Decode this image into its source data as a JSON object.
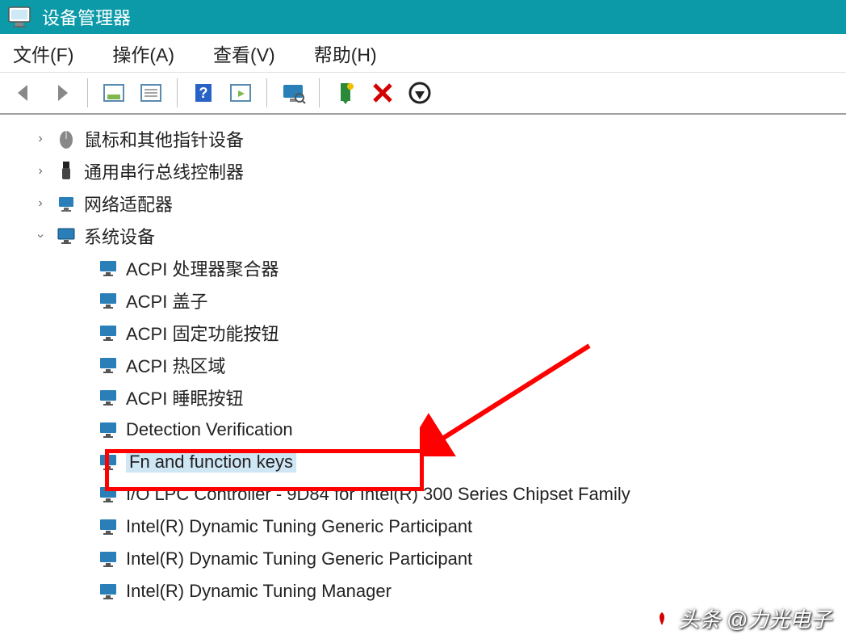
{
  "window": {
    "title": "设备管理器"
  },
  "menu": {
    "file": "文件(F)",
    "action": "操作(A)",
    "view": "查看(V)",
    "help": "帮助(H)"
  },
  "tree": {
    "nodes": [
      {
        "label": "鼠标和其他指针设备",
        "icon": "mouse",
        "expandable": true,
        "expanded": false
      },
      {
        "label": "通用串行总线控制器",
        "icon": "usb",
        "expandable": true,
        "expanded": false
      },
      {
        "label": "网络适配器",
        "icon": "network",
        "expandable": true,
        "expanded": false
      },
      {
        "label": "系统设备",
        "icon": "monitor",
        "expandable": true,
        "expanded": true,
        "children": [
          {
            "label": "ACPI 处理器聚合器"
          },
          {
            "label": "ACPI 盖子"
          },
          {
            "label": "ACPI 固定功能按钮"
          },
          {
            "label": "ACPI 热区域"
          },
          {
            "label": "ACPI 睡眠按钮"
          },
          {
            "label": "Detection Verification"
          },
          {
            "label": "Fn and function keys",
            "selected": true,
            "highlighted": true
          },
          {
            "label": "I/O LPC Controller - 9D84 for Intel(R) 300 Series Chipset Family"
          },
          {
            "label": "Intel(R) Dynamic Tuning Generic Participant"
          },
          {
            "label": "Intel(R) Dynamic Tuning Generic Participant"
          },
          {
            "label": "Intel(R) Dynamic Tuning Manager"
          }
        ]
      }
    ]
  },
  "watermark": "头条 @力光电子"
}
